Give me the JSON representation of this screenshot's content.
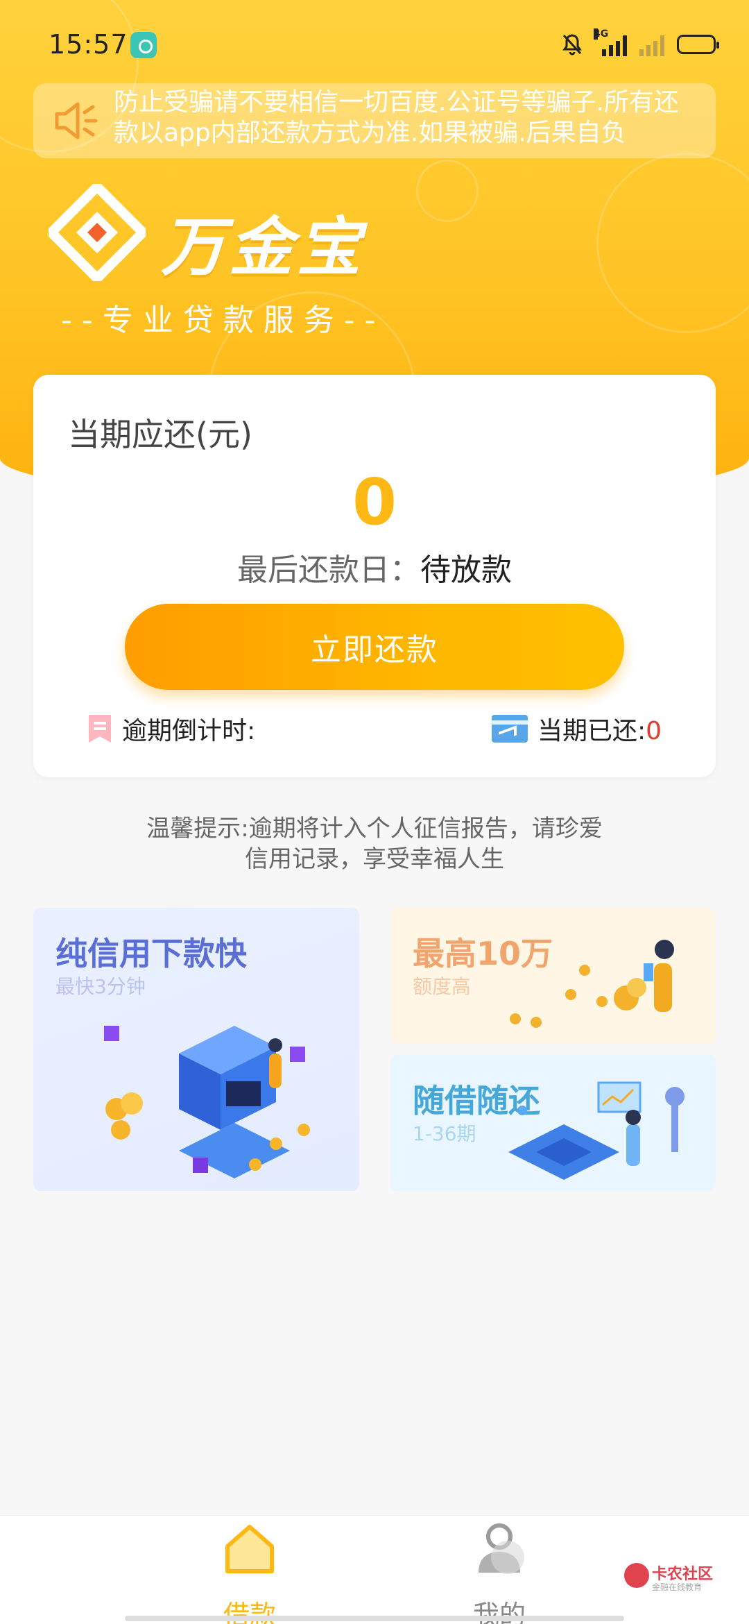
{
  "status_bar": {
    "time": "15:57",
    "network_label": "4G"
  },
  "notice": {
    "text": "防止受骗请不要相信一切百度.公证号等骗子.所有还款以app内部还款方式为准.如果被骗.后果自负"
  },
  "brand": {
    "name": "万金宝",
    "slogan": "--专业贷款服务--"
  },
  "repayment_card": {
    "title": "当期应还(元)",
    "amount": "0",
    "due_label": "最后还款日：",
    "due_value": "待放款",
    "button_label": "立即还款",
    "overdue_label": "逾期倒计时:",
    "paid_label": "当期已还:",
    "paid_value": "0"
  },
  "tip": {
    "text": "温馨提示:逾期将计入个人征信报告，请珍爱信用记录，享受幸福人生"
  },
  "features": [
    {
      "title": "纯信用下款快",
      "subtitle": "最快3分钟"
    },
    {
      "title": "最高10万",
      "subtitle": "额度高"
    },
    {
      "title": "随借随还",
      "subtitle": "1-36期"
    }
  ],
  "bottom_nav": {
    "loan_label": "借款",
    "mine_label": "我的"
  },
  "watermark": {
    "title": "卡农社区",
    "subtitle": "金融在线教育"
  },
  "colors": {
    "accent": "#fdb813",
    "header_yellow": "#ffc425",
    "button_orange": "#ff9d00",
    "paid_red": "#e23a2c"
  }
}
